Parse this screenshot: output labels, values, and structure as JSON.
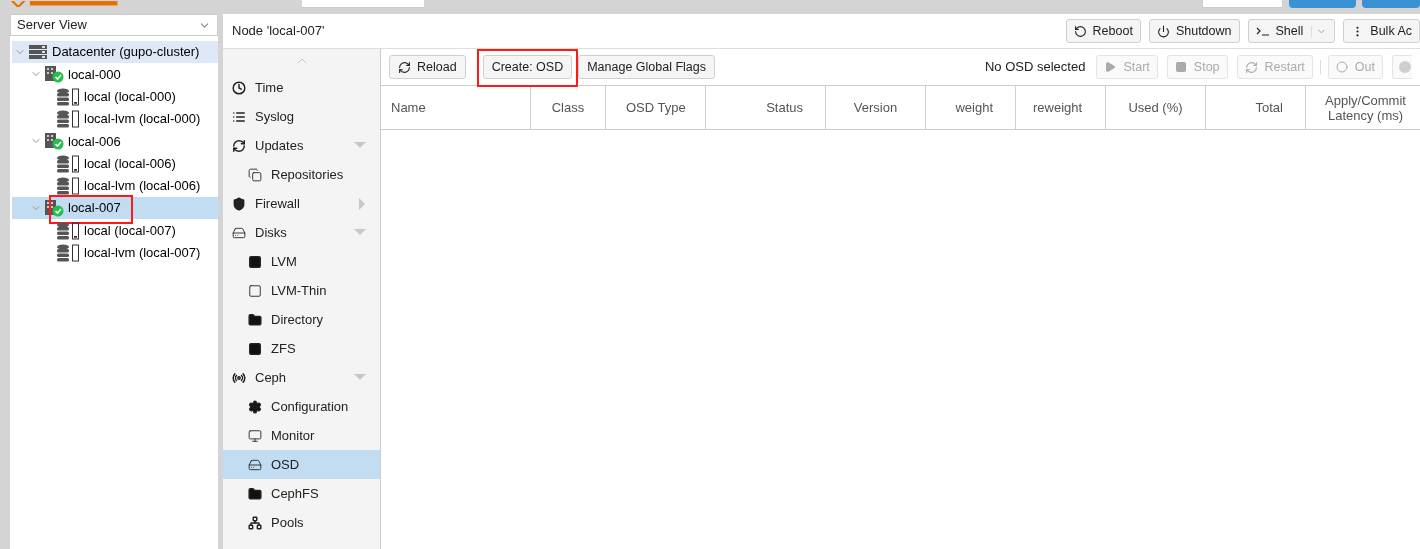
{
  "tree_header": {
    "value": "Server View"
  },
  "tree": [
    {
      "kind": "datacenter",
      "label": "Datacenter (gupo-cluster)",
      "selected": false,
      "highlighted": false,
      "children": [
        {
          "kind": "node",
          "label": "local-000",
          "selected": false,
          "highlighted": false,
          "children": [
            {
              "kind": "storage",
              "label": "local (local-000)",
              "selected": false,
              "highlighted": false
            },
            {
              "kind": "storage-lvm",
              "label": "local-lvm (local-000)",
              "selected": false,
              "highlighted": false
            }
          ]
        },
        {
          "kind": "node",
          "label": "local-006",
          "selected": false,
          "highlighted": false,
          "children": [
            {
              "kind": "storage",
              "label": "local (local-006)",
              "selected": false,
              "highlighted": false
            },
            {
              "kind": "storage-lvm",
              "label": "local-lvm (local-006)",
              "selected": false,
              "highlighted": false
            }
          ]
        },
        {
          "kind": "node",
          "label": "local-007",
          "selected": true,
          "highlighted": true,
          "children": [
            {
              "kind": "storage",
              "label": "local (local-007)",
              "selected": false,
              "highlighted": false
            },
            {
              "kind": "storage-lvm",
              "label": "local-lvm (local-007)",
              "selected": false,
              "highlighted": false
            }
          ]
        }
      ]
    }
  ],
  "node_title": "Node 'local-007'",
  "node_buttons": [
    {
      "kind": "reboot",
      "label": "Reboot"
    },
    {
      "kind": "shutdown",
      "label": "Shutdown"
    },
    {
      "kind": "shell",
      "label": "Shell"
    },
    {
      "kind": "bulk",
      "label": "Bulk Ac"
    }
  ],
  "menu": [
    {
      "kind": "time",
      "label": "Time",
      "selected": false
    },
    {
      "kind": "syslog",
      "label": "Syslog",
      "selected": false
    },
    {
      "kind": "updates",
      "label": "Updates",
      "selected": false,
      "expanded": true,
      "children": [
        {
          "kind": "repos",
          "label": "Repositories",
          "selected": false
        }
      ]
    },
    {
      "kind": "firewall",
      "label": "Firewall",
      "selected": false,
      "expanded": false
    },
    {
      "kind": "disks",
      "label": "Disks",
      "selected": false,
      "expanded": true,
      "children": [
        {
          "kind": "lvm",
          "label": "LVM",
          "selected": false
        },
        {
          "kind": "lvmthin",
          "label": "LVM-Thin",
          "selected": false
        },
        {
          "kind": "folder",
          "label": "Directory",
          "selected": false
        },
        {
          "kind": "zfs",
          "label": "ZFS",
          "selected": false
        }
      ]
    },
    {
      "kind": "ceph",
      "label": "Ceph",
      "selected": false,
      "expanded": true,
      "children": [
        {
          "kind": "gear",
          "label": "Configuration",
          "selected": false
        },
        {
          "kind": "monitor",
          "label": "Monitor",
          "selected": false
        },
        {
          "kind": "osd",
          "label": "OSD",
          "selected": true
        },
        {
          "kind": "folder",
          "label": "CephFS",
          "selected": false
        },
        {
          "kind": "pools",
          "label": "Pools",
          "selected": false
        }
      ]
    }
  ],
  "toolbar": {
    "left": [
      {
        "kind": "reload",
        "label": "Reload",
        "highlighted": false
      },
      {
        "kind": "plain",
        "label": "Create: OSD",
        "highlighted": true
      },
      {
        "kind": "plain",
        "label": "Manage Global Flags",
        "highlighted": false
      }
    ],
    "status": "No OSD selected",
    "right": [
      {
        "kind": "start",
        "label": "Start",
        "disabled": true
      },
      {
        "kind": "stop",
        "label": "Stop",
        "disabled": true
      },
      {
        "kind": "restart",
        "label": "Restart",
        "disabled": true
      },
      {
        "kind": "out",
        "label": "Out",
        "disabled": true
      }
    ]
  },
  "table": {
    "columns": [
      "Name",
      "Class",
      "OSD Type",
      "Status",
      "Version",
      "weight",
      "reweight",
      "Used (%)",
      "Total",
      "Apply/Commit Latency (ms)"
    ]
  }
}
